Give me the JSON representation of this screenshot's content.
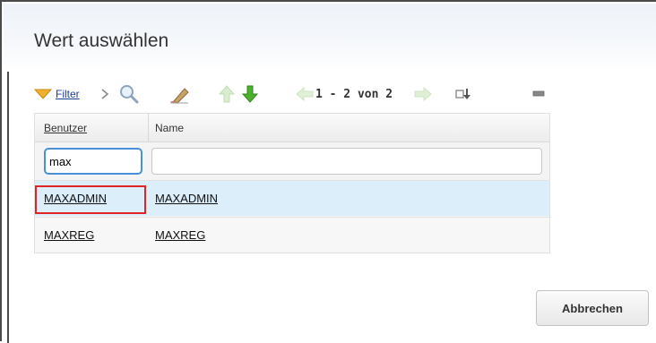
{
  "dialog": {
    "title": "Wert auswählen"
  },
  "toolbar": {
    "filter_label": "Filter",
    "pager_text": "1 - 2 von 2",
    "icons": [
      "filter-funnel-icon",
      "chevron-right-icon",
      "search-icon",
      "clear-filter-eraser-icon",
      "sort-up-icon",
      "sort-down-icon",
      "previous-page-icon",
      "next-page-icon",
      "download-icon",
      "minimize-icon"
    ]
  },
  "table": {
    "columns": [
      "Benutzer",
      "Name"
    ],
    "filter_values": {
      "benutzer": "max",
      "name": ""
    },
    "rows": [
      {
        "benutzer": "MAXADMIN",
        "name": "MAXADMIN",
        "selected": true
      },
      {
        "benutzer": "MAXREG",
        "name": "MAXREG",
        "selected": false
      }
    ]
  },
  "buttons": {
    "cancel_label": "Abbrechen"
  },
  "colors": {
    "selected_row": "#dceefa",
    "highlight_border": "#e02424",
    "focus_border": "#4a90d9",
    "link": "#1a3e9a"
  }
}
